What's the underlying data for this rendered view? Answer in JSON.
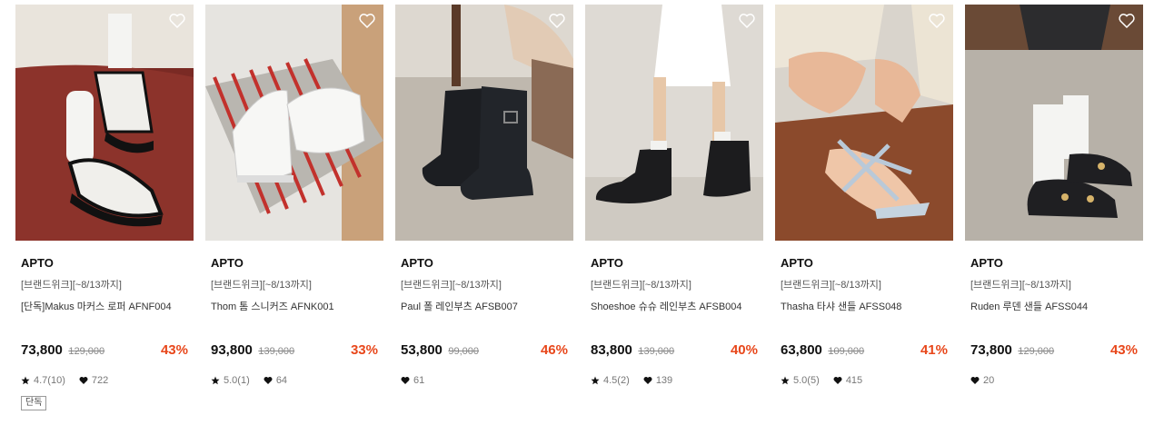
{
  "products": [
    {
      "brand": "APTO",
      "promo": "[브랜드위크][~8/13까지]",
      "name": "[단독]Makus 마커스 로퍼 AFNF004",
      "price": "73,800",
      "original_price": "129,000",
      "discount": "43%",
      "rating": "4.7(10)",
      "likes": "722",
      "tag": "단독",
      "image_icon": "loafer-photo"
    },
    {
      "brand": "APTO",
      "promo": "[브랜드위크][~8/13까지]",
      "name": "Thom 톰 스니커즈 AFNK001",
      "price": "93,800",
      "original_price": "139,000",
      "discount": "33%",
      "rating": "5.0(1)",
      "likes": "64",
      "image_icon": "sneaker-photo"
    },
    {
      "brand": "APTO",
      "promo": "[브랜드위크][~8/13까지]",
      "name": "Paul 폴 레인부츠 AFSB007",
      "price": "53,800",
      "original_price": "99,000",
      "discount": "46%",
      "likes": "61",
      "image_icon": "rainboot-photo"
    },
    {
      "brand": "APTO",
      "promo": "[브랜드위크][~8/13까지]",
      "name": "Shoeshoe 슈슈 레인부츠 AFSB004",
      "price": "83,800",
      "original_price": "139,000",
      "discount": "40%",
      "rating": "4.5(2)",
      "likes": "139",
      "image_icon": "rainboot-photo"
    },
    {
      "brand": "APTO",
      "promo": "[브랜드위크][~8/13까지]",
      "name": "Thasha 타샤 샌들 AFSS048",
      "price": "63,800",
      "original_price": "109,000",
      "discount": "41%",
      "rating": "5.0(5)",
      "likes": "415",
      "image_icon": "sandal-photo"
    },
    {
      "brand": "APTO",
      "promo": "[브랜드위크][~8/13까지]",
      "name": "Ruden 루덴 샌들 AFSS044",
      "price": "73,800",
      "original_price": "129,000",
      "discount": "43%",
      "likes": "20",
      "image_icon": "sandal-photo"
    }
  ],
  "colors": {
    "discount": "#e8471b",
    "text": "#111111",
    "muted": "#888888"
  }
}
